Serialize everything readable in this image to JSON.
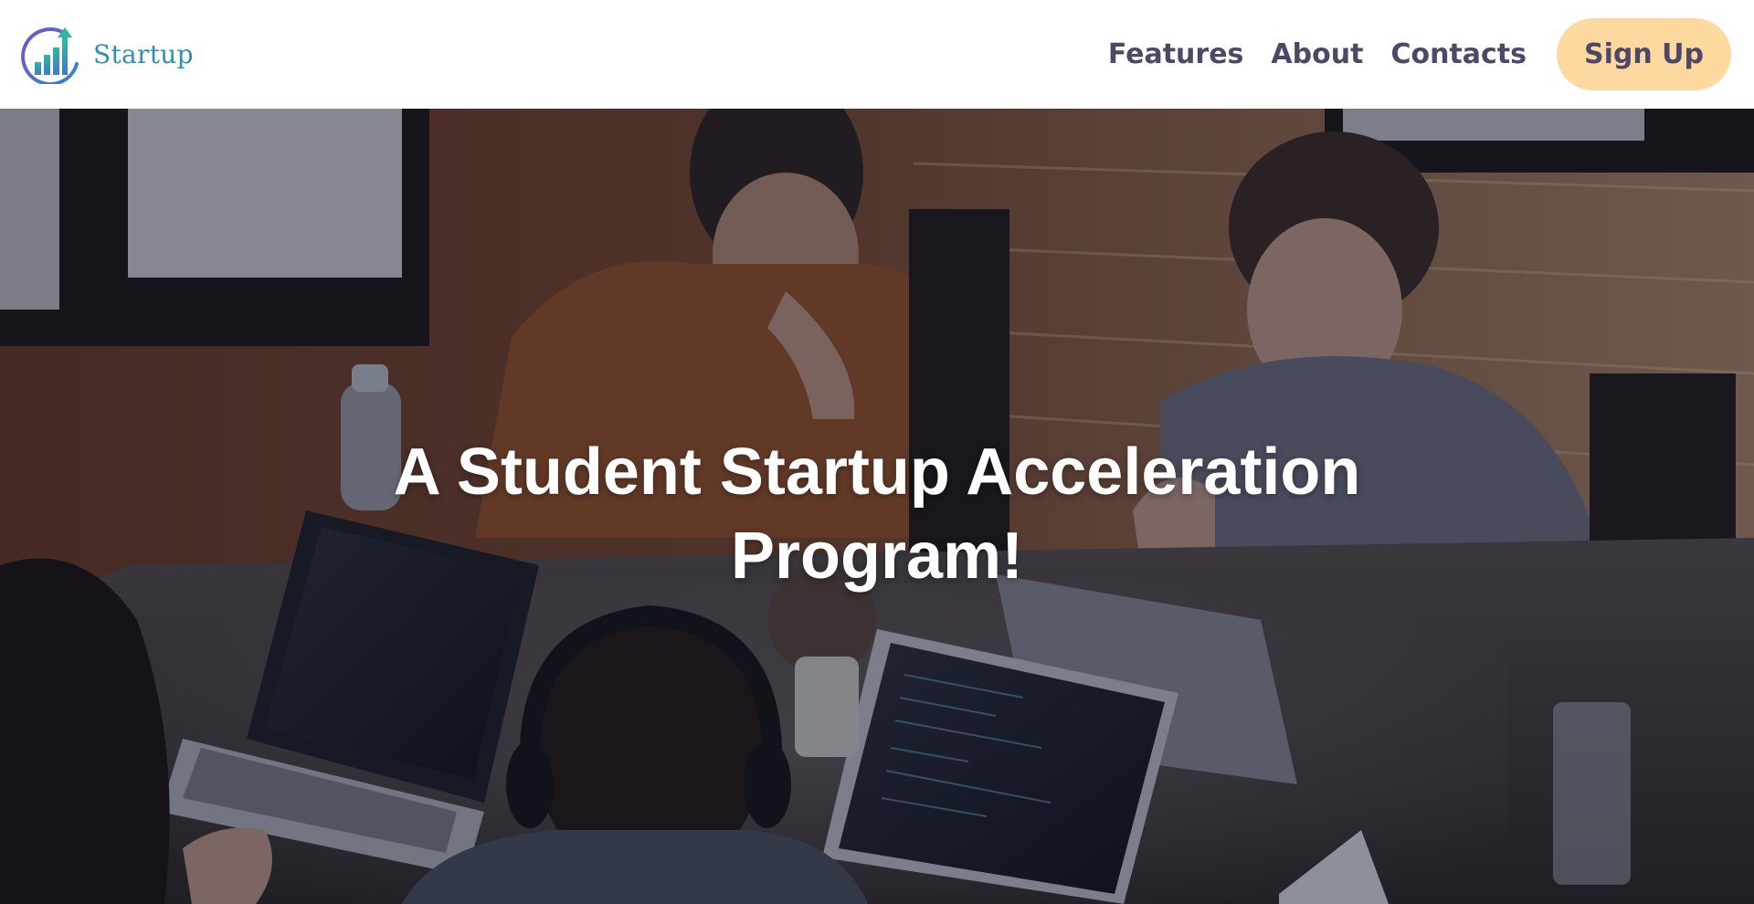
{
  "header": {
    "logo_text": "Startup",
    "nav": [
      {
        "label": "Features"
      },
      {
        "label": "About"
      },
      {
        "label": "Contacts"
      }
    ],
    "signup_label": "Sign Up"
  },
  "hero": {
    "title": "A Student Startup Acceleration Program!"
  },
  "colors": {
    "brand": "#2e8fb8",
    "nav_text": "#4e4868",
    "signup_bg": "#fdd9a0",
    "hero_text": "#ffffff"
  }
}
